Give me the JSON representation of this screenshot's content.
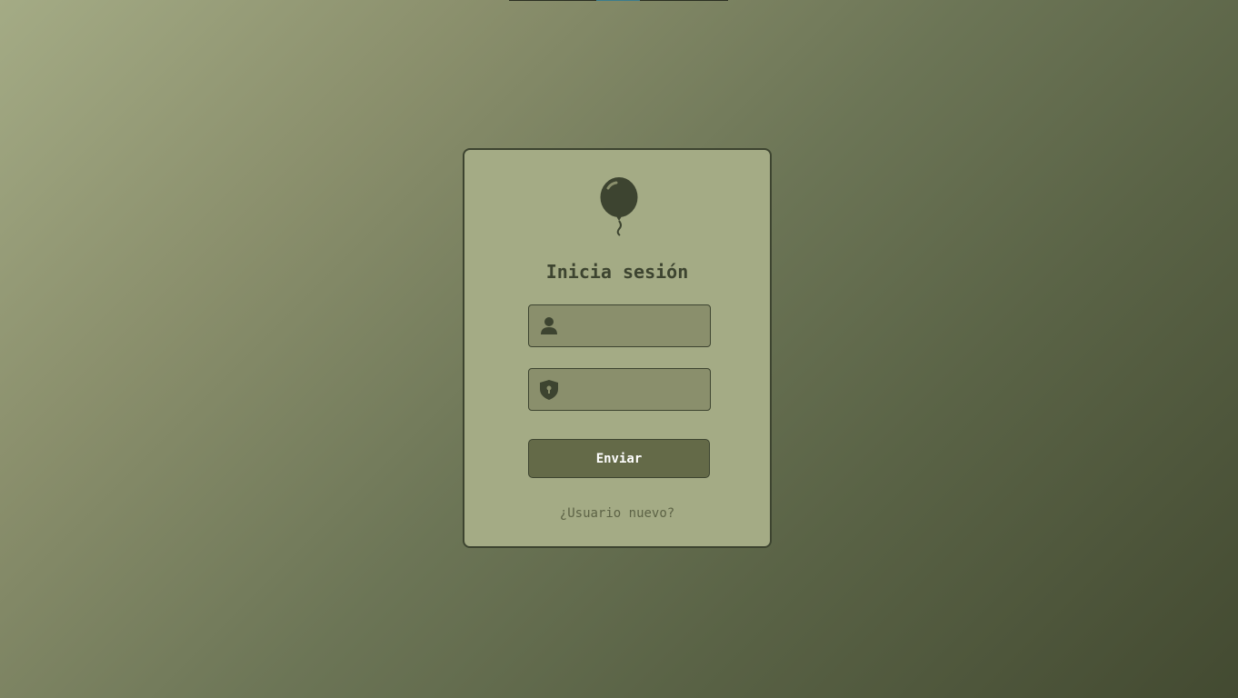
{
  "page": {
    "background_start": "#a4ab85",
    "background_end": "#434a31",
    "accent_color": "#3b7c8c"
  },
  "card": {
    "logo_icon": "balloon-icon",
    "title": "Inicia sesión",
    "username": {
      "icon": "user-icon",
      "value": "",
      "placeholder": ""
    },
    "password": {
      "icon": "shield-keyhole-icon",
      "value": "",
      "placeholder": ""
    },
    "submit_label": "Enviar",
    "new_user_link": "¿Usuario nuevo?",
    "colors": {
      "card_bg": "#a4ab85",
      "field_bg": "#8a8f6c",
      "button_bg": "#646a48",
      "text_dark": "#3d4430"
    }
  }
}
